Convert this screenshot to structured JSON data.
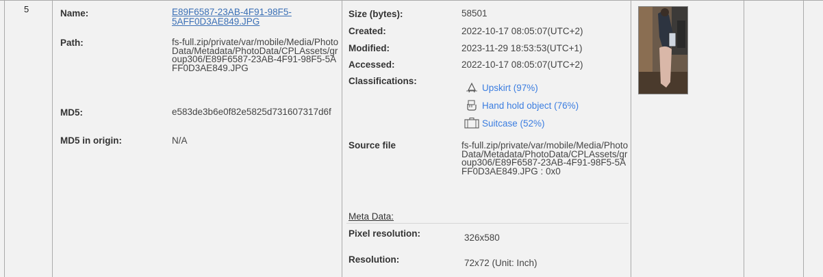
{
  "row": {
    "index": "5",
    "name_label": "Name:",
    "name_value": "E89F6587-23AB-4F91-98F5-5AFF0D3AE849.JPG",
    "path_label": "Path:",
    "path_value": "fs-full.zip/private/var/mobile/Media/PhotoData/Metadata/PhotoData/CPLAssets/group306/E89F6587-23AB-4F91-98F5-5AFF0D3AE849.JPG",
    "md5_label": "MD5:",
    "md5_value": "e583de3b6e0f82e5825d731607317d6f",
    "md5_origin_label": "MD5 in origin:",
    "md5_origin_value": "N/A",
    "size_label": "Size (bytes):",
    "size_value": "58501",
    "created_label": "Created:",
    "created_value": "2022-10-17 08:05:07(UTC+2)",
    "modified_label": "Modified:",
    "modified_value": "2023-11-29 18:53:53(UTC+1)",
    "accessed_label": "Accessed:",
    "accessed_value": "2022-10-17 08:05:07(UTC+2)",
    "classifications_label": "Classifications:",
    "classifications": [
      {
        "label": "Upskirt (97%)",
        "icon": "upskirt-icon"
      },
      {
        "label": "Hand hold object (76%)",
        "icon": "hand-hold-icon"
      },
      {
        "label": "Suitcase (52%)",
        "icon": "suitcase-icon"
      }
    ],
    "source_label": "Source file",
    "source_value": "fs-full.zip/private/var/mobile/Media/PhotoData/Metadata/PhotoData/CPLAssets/group306/E89F6587-23AB-4F91-98F5-5AFF0D3AE849.JPG : 0x0",
    "meta_heading": "Meta Data:",
    "pixel_res_label": "Pixel resolution:",
    "pixel_res_value": "326x580",
    "resolution_label": "Resolution:",
    "resolution_value": "72x72 (Unit: Inch)"
  },
  "colors": {
    "link": "#3a6fb5",
    "classification": "#3b7de0",
    "row_bg": "#f2f2f2",
    "border": "#aaaaaa"
  }
}
